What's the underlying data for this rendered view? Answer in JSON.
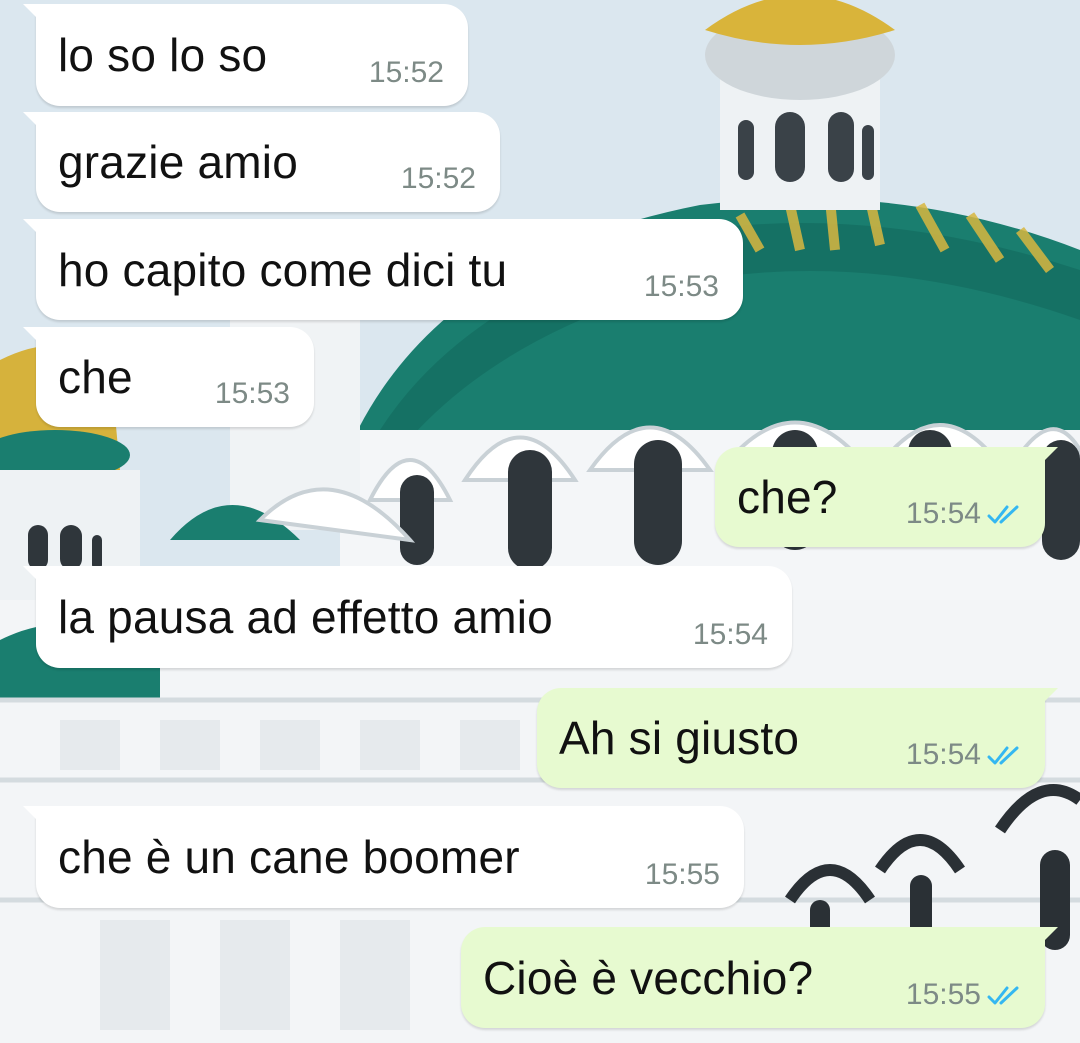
{
  "messages": [
    {
      "direction": "in",
      "text": "lo so lo so",
      "time": "15:52"
    },
    {
      "direction": "in",
      "text": "grazie amio",
      "time": "15:52"
    },
    {
      "direction": "in",
      "text": "ho capito come dici tu",
      "time": "15:53"
    },
    {
      "direction": "in",
      "text": "che",
      "time": "15:53"
    },
    {
      "direction": "out",
      "text": "che?",
      "time": "15:54",
      "status": "read"
    },
    {
      "direction": "in",
      "text": "la pausa ad effetto amio",
      "time": "15:54"
    },
    {
      "direction": "out",
      "text": "Ah si giusto",
      "time": "15:54",
      "status": "read"
    },
    {
      "direction": "in",
      "text": "che è un cane boomer",
      "time": "15:55"
    },
    {
      "direction": "out",
      "text": "Cioè è vecchio?",
      "time": "15:55",
      "status": "read"
    }
  ],
  "colors": {
    "incoming_bubble": "#ffffff",
    "outgoing_bubble": "#e7fad0",
    "read_ticks": "#34b7f1",
    "timestamp": "#7d8a86"
  },
  "icons": {
    "read_status": "double-check-icon",
    "wallpaper": "cathedral-domes-wallpaper"
  }
}
